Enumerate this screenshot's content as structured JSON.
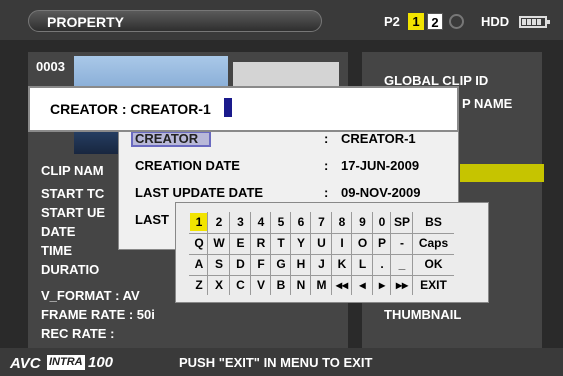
{
  "header": {
    "title": "PROPERTY",
    "media_p2": "P2",
    "slot_1": "1",
    "slot_2": "2",
    "media_hdd": "HDD"
  },
  "clip": {
    "number": "0003"
  },
  "left_fields": {
    "clip_name": "CLIP NAM",
    "start_tc": "START TC",
    "start_ub": "START UE",
    "date": "DATE",
    "time": "TIME",
    "duration": "DURATIO",
    "v_format": "V_FORMAT   : AV",
    "frame_rate": "FRAME RATE : 50i",
    "rec_rate": "REC RATE    :"
  },
  "right_fields": {
    "global_clip_id": "GLOBAL CLIP ID",
    "p_name": "P NAME",
    "thumbnail": "THUMBNAIL"
  },
  "property_list": [
    {
      "label": "CREATOR",
      "colon": ":",
      "value": "CREATOR-1"
    },
    {
      "label": "CREATION DATE",
      "colon": ":",
      "value": "17-JUN-2009"
    },
    {
      "label": "LAST UPDATE DATE",
      "colon": ":",
      "value": "09-NOV-2009"
    },
    {
      "label": "LAST",
      "colon": "",
      "value": ""
    }
  ],
  "edit_field": {
    "label": "CREATOR : ",
    "value": "CREATOR-1"
  },
  "keyboard": {
    "rows": [
      [
        "1",
        "2",
        "3",
        "4",
        "5",
        "6",
        "7",
        "8",
        "9",
        "0",
        "SP",
        "BS"
      ],
      [
        "Q",
        "W",
        "E",
        "R",
        "T",
        "Y",
        "U",
        "I",
        "O",
        "P",
        "-",
        "Caps"
      ],
      [
        "A",
        "S",
        "D",
        "F",
        "G",
        "H",
        "J",
        "K",
        "L",
        ".",
        "_",
        "OK"
      ],
      [
        "Z",
        "X",
        "C",
        "V",
        "B",
        "N",
        "M",
        "◂◂",
        "◂",
        "▸",
        "▸▸",
        "EXIT"
      ]
    ],
    "selected": "1"
  },
  "footer": {
    "codec_avc": "AVC",
    "codec_intra": "INTRA",
    "codec_100": "100",
    "status": "PUSH \"EXIT\" IN MENU TO EXIT"
  },
  "colors": {
    "highlight": "#f2e400",
    "cursor": "#1a1a8c",
    "accent_bar": "#c6c400"
  }
}
